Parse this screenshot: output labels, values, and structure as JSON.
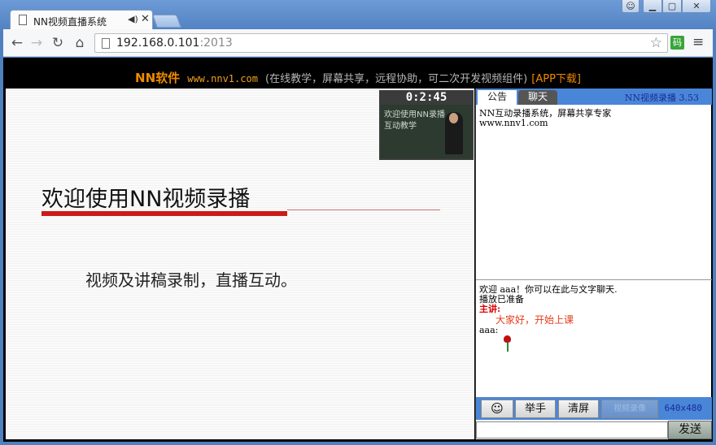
{
  "browser": {
    "tab_title": "NN视频直播系统",
    "audio_icon": "speaker-icon",
    "close_glyph": "✕",
    "url_host": "192.168.0.101",
    "url_port": ":2013",
    "ext_label": "码"
  },
  "banner": {
    "brand": "NN软件",
    "site": "www.nnv1.com",
    "desc": "(在线教学，屏幕共享，远程协助，可二次开发视频组件)",
    "app_link": "[APP下载]"
  },
  "slide": {
    "title": "欢迎使用NN视频录播",
    "body": "视频及讲稿录制，直播互动。"
  },
  "camera": {
    "timer": "0:2:45",
    "board_text": "欢迎使用NN录播\n互动教学"
  },
  "panel": {
    "tab_notice": "公告",
    "tab_chat": "聊天",
    "version": "NN视频录播 3.53",
    "notice_line1": "NN互动录播系统，屏幕共享专家",
    "notice_line2": "www.nnv1.com"
  },
  "chat": {
    "welcome": "欢迎 aaa！你可以在此与文字聊天.",
    "status": "播放已准备",
    "teacher_label": "主讲:",
    "teacher_msg": "大家好，开始上课",
    "user_label": "aaa:"
  },
  "controls": {
    "raise_hand": "举手",
    "clear_screen": "清屏",
    "record_label": "视频录像",
    "resolution": "640x480",
    "send": "发送"
  },
  "colors": {
    "accent_blue": "#4a86d8",
    "brand_orange": "#f08a00",
    "title_red": "#cc1a1a"
  }
}
